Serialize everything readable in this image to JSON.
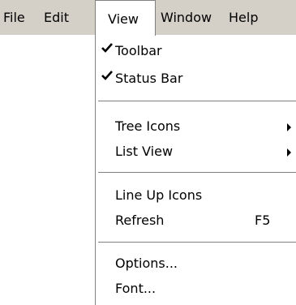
{
  "menubar": {
    "items": [
      {
        "label": "File"
      },
      {
        "label": "Edit"
      },
      {
        "label": "View"
      },
      {
        "label": "Window"
      },
      {
        "label": "Help"
      }
    ],
    "active_item": "View"
  },
  "view_menu": {
    "items": [
      {
        "label": "Toolbar",
        "checked": true
      },
      {
        "label": "Status Bar",
        "checked": true
      },
      {
        "label": "Tree Icons",
        "submenu": true
      },
      {
        "label": "List View",
        "submenu": true
      },
      {
        "label": "Line Up Icons"
      },
      {
        "label": "Refresh",
        "shortcut": "F5"
      },
      {
        "label": "Options..."
      },
      {
        "label": "Font..."
      }
    ]
  },
  "colors": {
    "menubar_background": "#d4d0c8",
    "menu_background": "#ffffff",
    "text": "#000000",
    "separator_shadow": "#808080"
  }
}
